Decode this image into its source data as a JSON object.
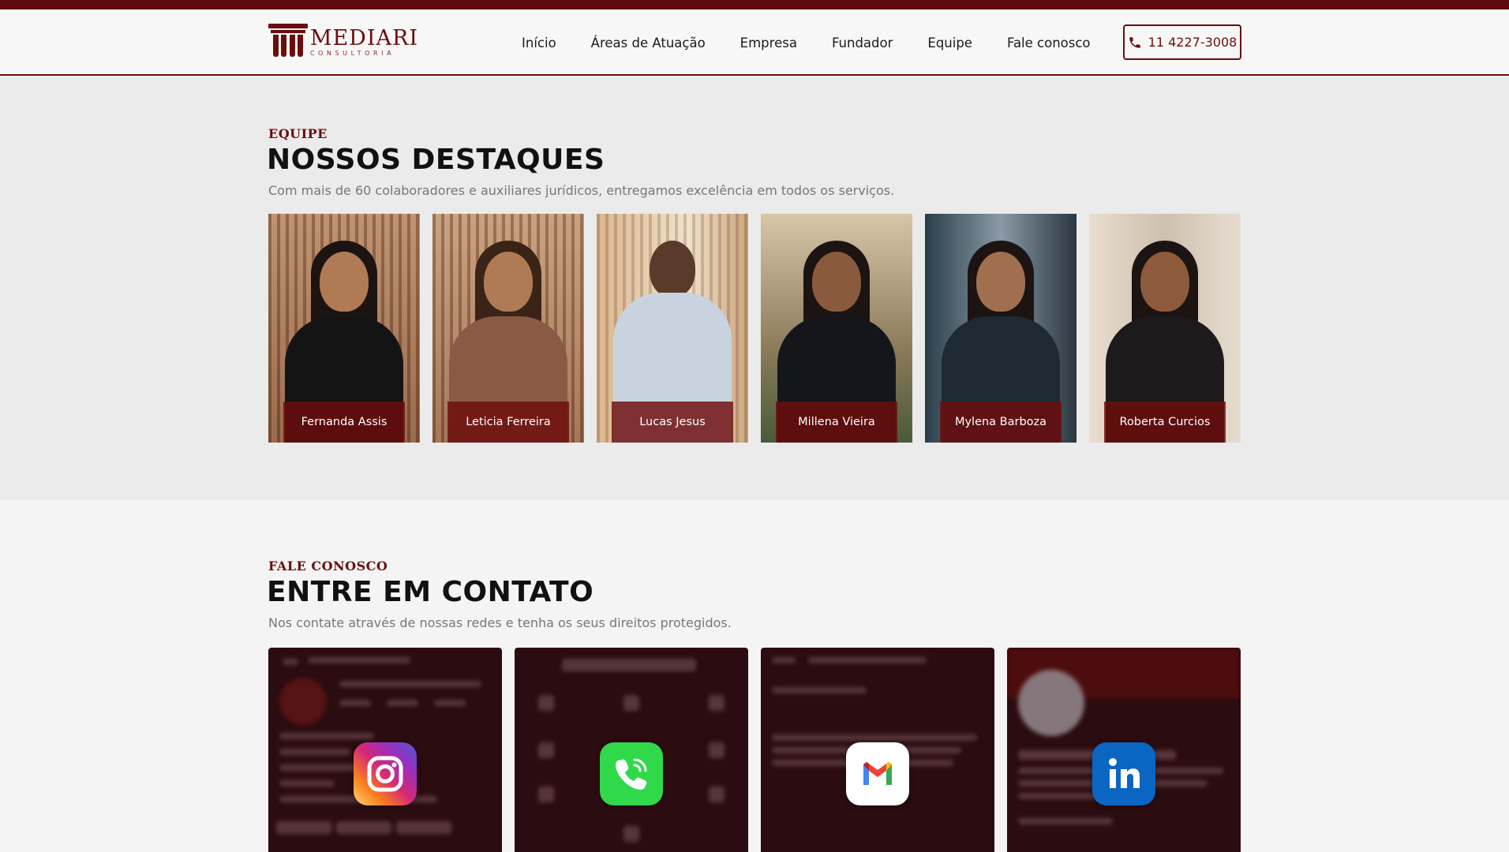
{
  "brand": {
    "name": "MEDIARI",
    "sub": "CONSULTORIA",
    "color": "#6b0d0d"
  },
  "nav": {
    "items": [
      {
        "label": "Início"
      },
      {
        "label": "Áreas de Atuação"
      },
      {
        "label": "Empresa"
      },
      {
        "label": "Fundador"
      },
      {
        "label": "Equipe"
      },
      {
        "label": "Fale conosco"
      }
    ],
    "phone": "11 4227-3008"
  },
  "team": {
    "kicker": "EQUIPE",
    "title": "NOSSOS DESTAQUES",
    "description": "Com mais de 60 colaboradores e auxiliares jurídicos, entregamos excelência em todos os serviços.",
    "members": [
      {
        "name": "Fernanda Assis",
        "outfit": "#141414"
      },
      {
        "name": "Leticia Ferreira",
        "outfit": "#8a5a45"
      },
      {
        "name": "Lucas Jesus",
        "outfit": "#c9d3e0"
      },
      {
        "name": "Millena Vieira",
        "outfit": "#15161c"
      },
      {
        "name": "Mylena Barboza",
        "outfit": "#1d2a33"
      },
      {
        "name": "Roberta Curcios",
        "outfit": "#1c1a1a"
      }
    ]
  },
  "contact": {
    "kicker": "FALE CONOSCO",
    "title": "ENTRE EM CONTATO",
    "description": "Nos contate através de nossas redes e tenha os seus direitos protegidos.",
    "channels": [
      {
        "icon": "instagram-icon"
      },
      {
        "icon": "phone-call-icon"
      },
      {
        "icon": "gmail-icon"
      },
      {
        "icon": "linkedin-icon"
      }
    ]
  }
}
